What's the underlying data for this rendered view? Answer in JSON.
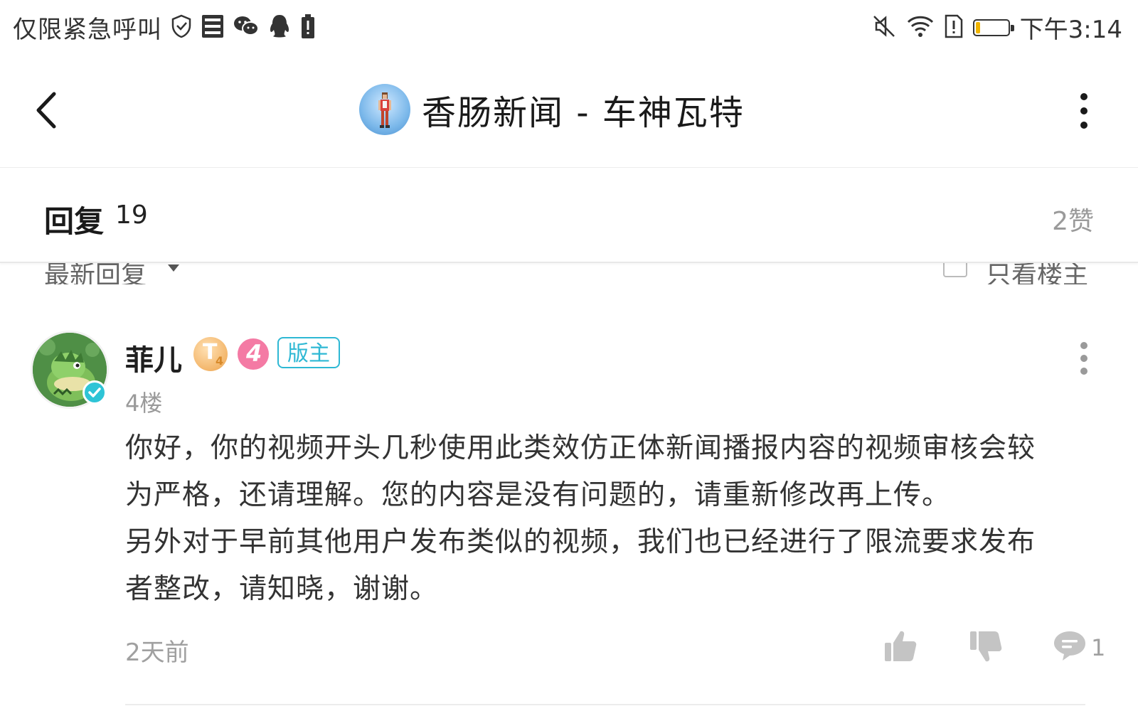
{
  "status_bar": {
    "carrier": "仅限紧急呼叫",
    "time": "下午3:14",
    "battery_level": 0.15,
    "battery_color": "#f0b400",
    "left_icons": [
      "shield-icon",
      "storage-icon",
      "wechat-icon",
      "qq-icon",
      "battery-alert-icon"
    ],
    "right_icons": [
      "mute-icon",
      "wifi-icon",
      "sim-alert-icon",
      "battery-icon"
    ]
  },
  "nav": {
    "title": "香肠新闻 - 车神瓦特",
    "back_icon": "chevron-left-icon",
    "more_icon": "more-vertical-icon"
  },
  "reply_header": {
    "title": "回复",
    "count": "19",
    "likes": "2赞"
  },
  "sort_bar": {
    "sort_label": "最新回复",
    "owner_only_label": "只看楼主"
  },
  "comment": {
    "author": "菲儿",
    "level_badge": "T",
    "level_sub": "4",
    "rank_badge": "4",
    "role": "版主",
    "floor": "4楼",
    "body_lines": [
      "你好，你的视频开头几秒使用此类效仿正体新闻播报内容的视频审核会较",
      "为严格，还请理解。您的内容是没有问题的，请重新修改再上传。",
      "另外对于早前其他用户发布类似的视频，我们也已经进行了限流要求发布",
      "者整改，请知晓，谢谢。"
    ],
    "time": "2天前",
    "reply_count": "1",
    "accent_color": "#2eb8d4"
  }
}
